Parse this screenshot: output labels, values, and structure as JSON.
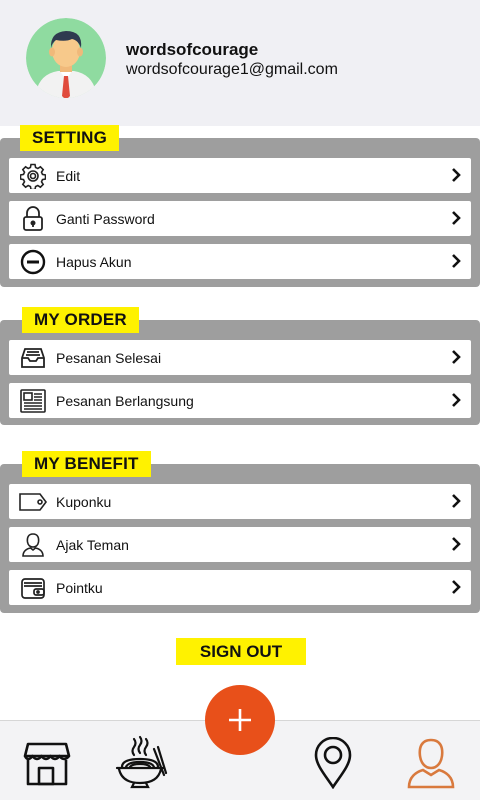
{
  "profile": {
    "username": "wordsofcourage",
    "email": "wordsofcourage1@gmail.com",
    "avatar_icon": "user-avatar-icon"
  },
  "sections": {
    "setting": {
      "title": "SETTING",
      "items": [
        {
          "label": "Edit",
          "icon": "gear-icon"
        },
        {
          "label": "Ganti Password",
          "icon": "lock-icon"
        },
        {
          "label": "Hapus Akun",
          "icon": "minus-circle-icon"
        }
      ]
    },
    "my_order": {
      "title": "MY ORDER",
      "items": [
        {
          "label": "Pesanan Selesai",
          "icon": "inbox-tray-icon"
        },
        {
          "label": "Pesanan Berlangsung",
          "icon": "newspaper-icon"
        }
      ]
    },
    "my_benefit": {
      "title": "MY BENEFIT",
      "items": [
        {
          "label": "Kuponku",
          "icon": "tag-icon"
        },
        {
          "label": "Ajak Teman",
          "icon": "person-icon"
        },
        {
          "label": "Pointku",
          "icon": "wallet-icon"
        }
      ]
    }
  },
  "sign_out_label": "SIGN OUT",
  "bottom_nav": {
    "items": [
      {
        "icon": "store-icon"
      },
      {
        "icon": "noodle-bowl-icon"
      },
      {
        "icon": "map-pin-icon"
      },
      {
        "icon": "profile-icon",
        "active": true
      }
    ],
    "fab_icon": "plus-icon"
  },
  "colors": {
    "accent_yellow": "#fff200",
    "panel_gray": "#9e9e9e",
    "fab_orange": "#e8501a",
    "active_nav": "#d97a3e"
  }
}
